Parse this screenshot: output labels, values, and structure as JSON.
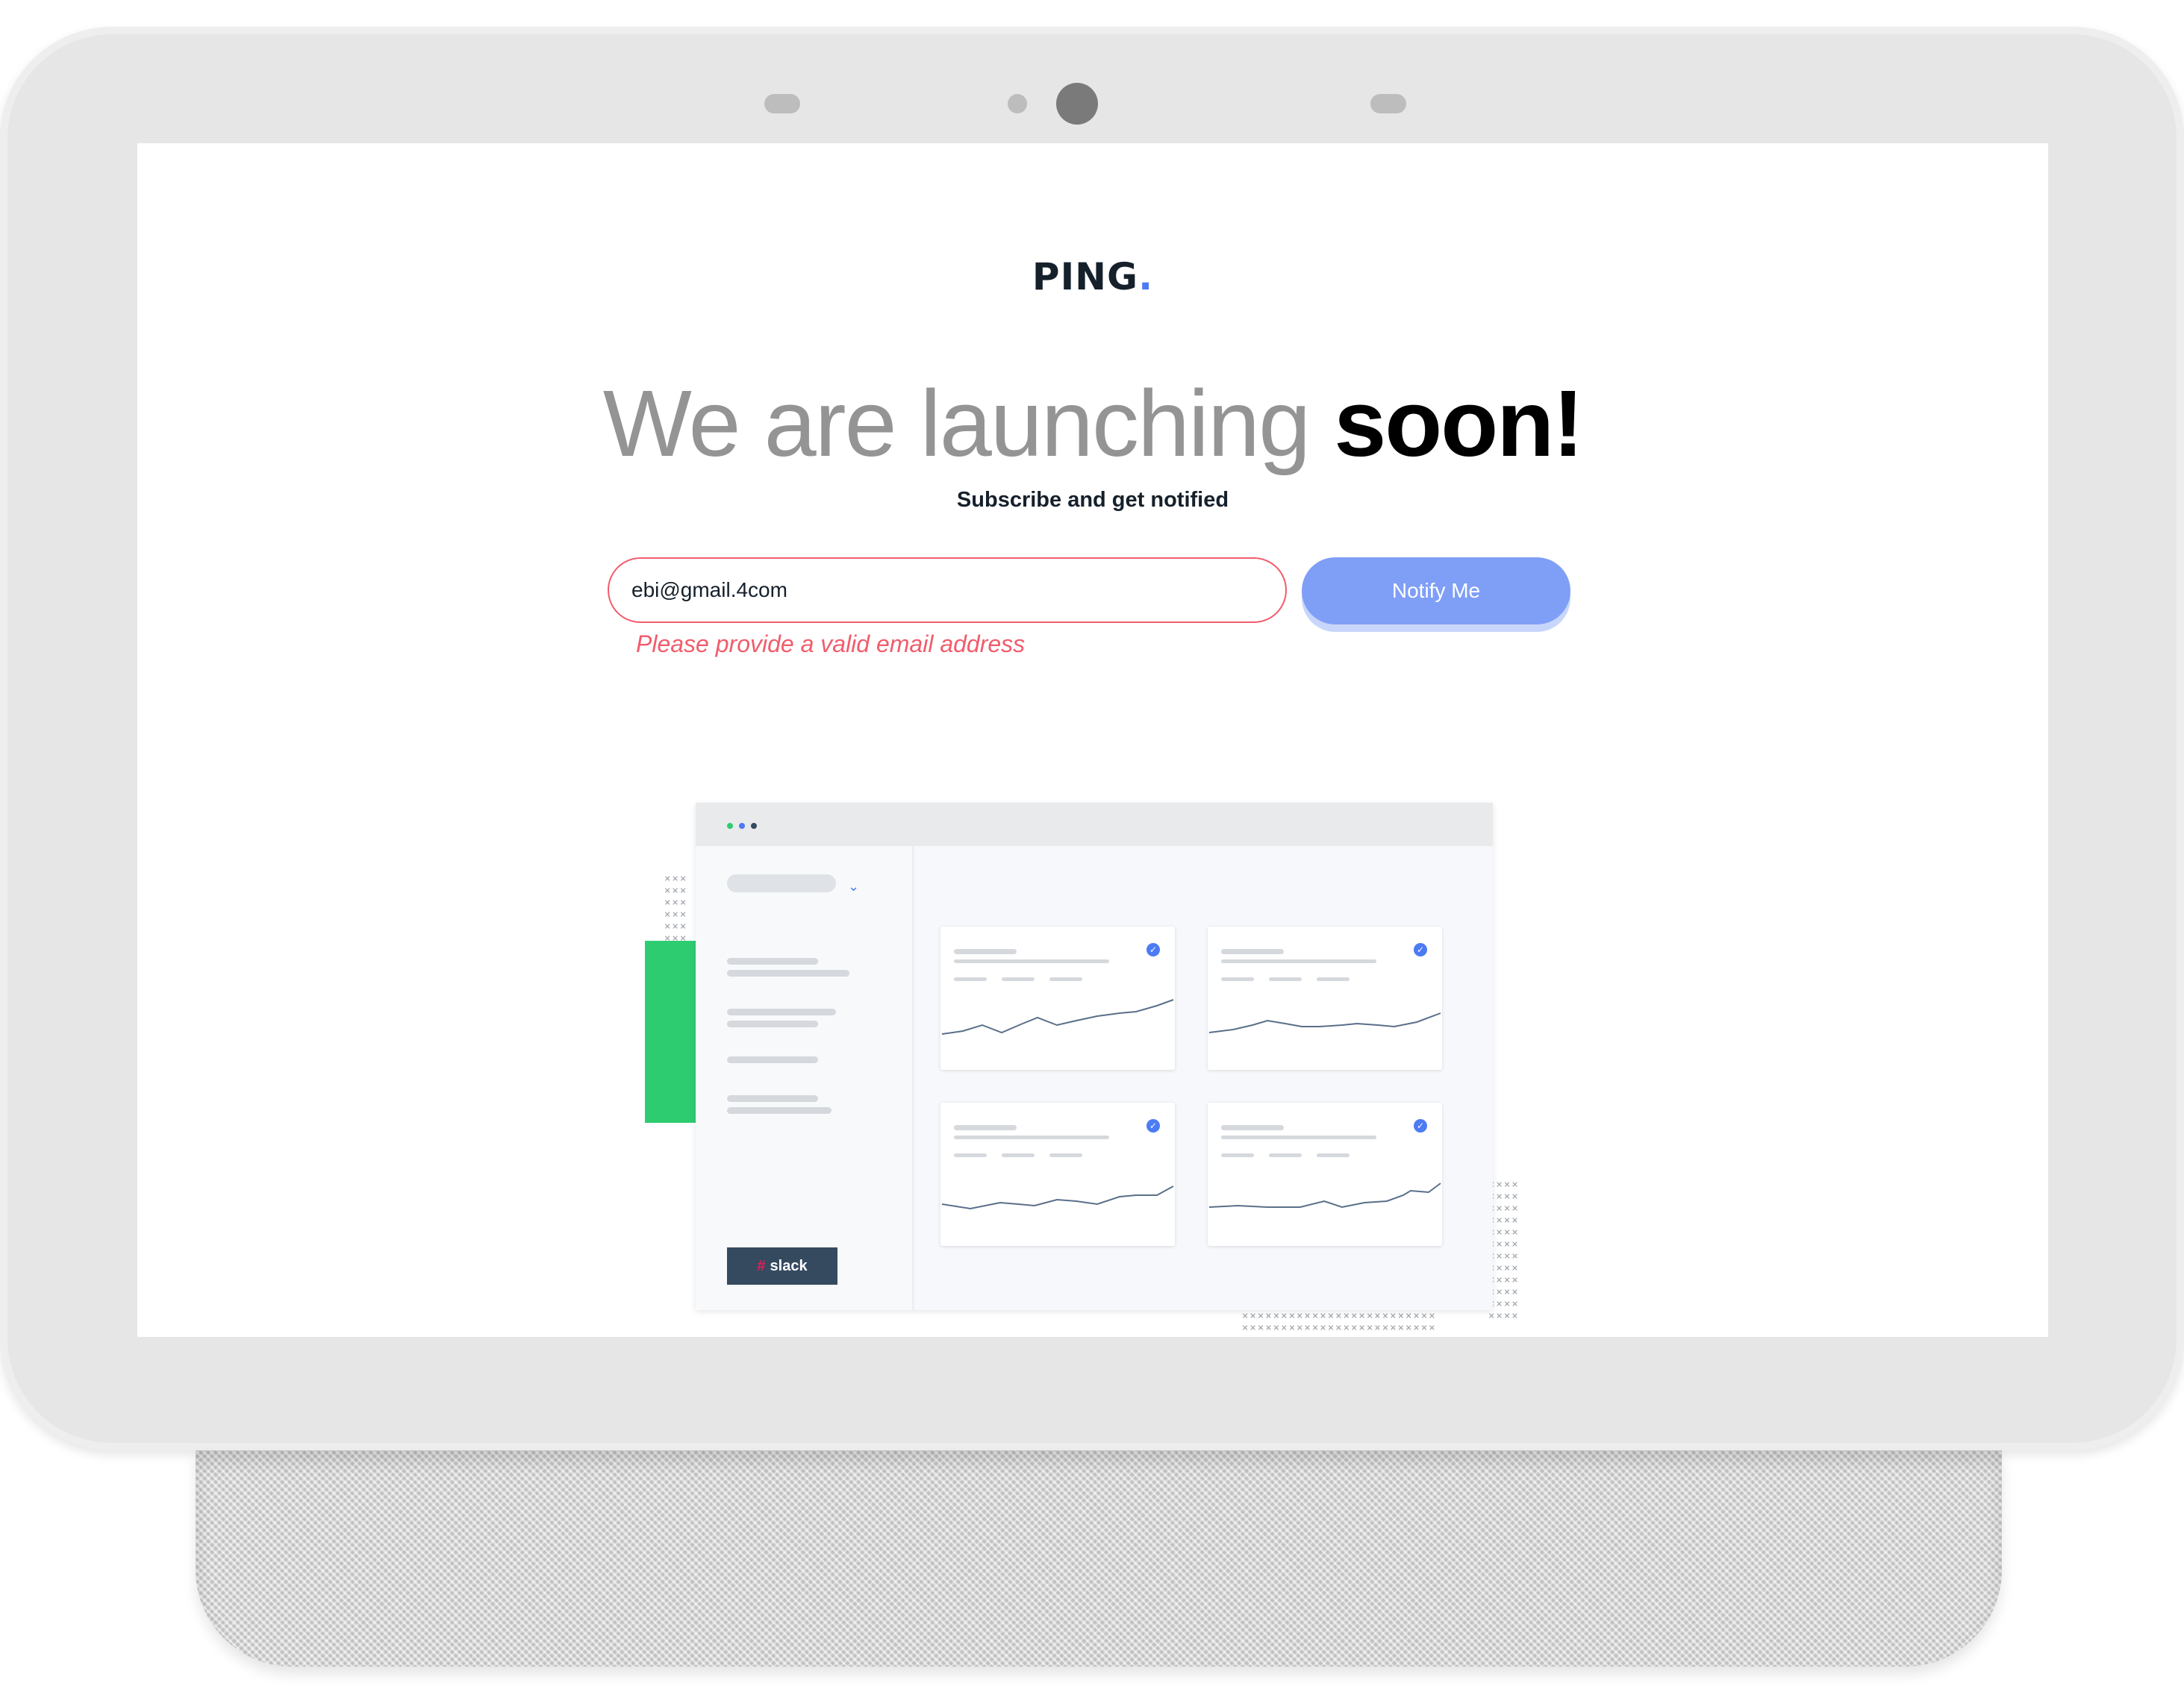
{
  "brand": {
    "name": "PING",
    "dot": "."
  },
  "headline": {
    "light": "We are launching",
    "bold": "soon!"
  },
  "subtitle": "Subscribe and get notified",
  "form": {
    "email_value": "ebi@gmail.4com",
    "button_label": "Notify Me",
    "error": "Please provide a valid email address"
  },
  "illustration": {
    "badge": "slack"
  },
  "colors": {
    "accent": "#4c7bf3",
    "button": "#7f9ef6",
    "error": "#f15c6c",
    "green": "#2ecc71",
    "text_dark": "#15202b"
  }
}
